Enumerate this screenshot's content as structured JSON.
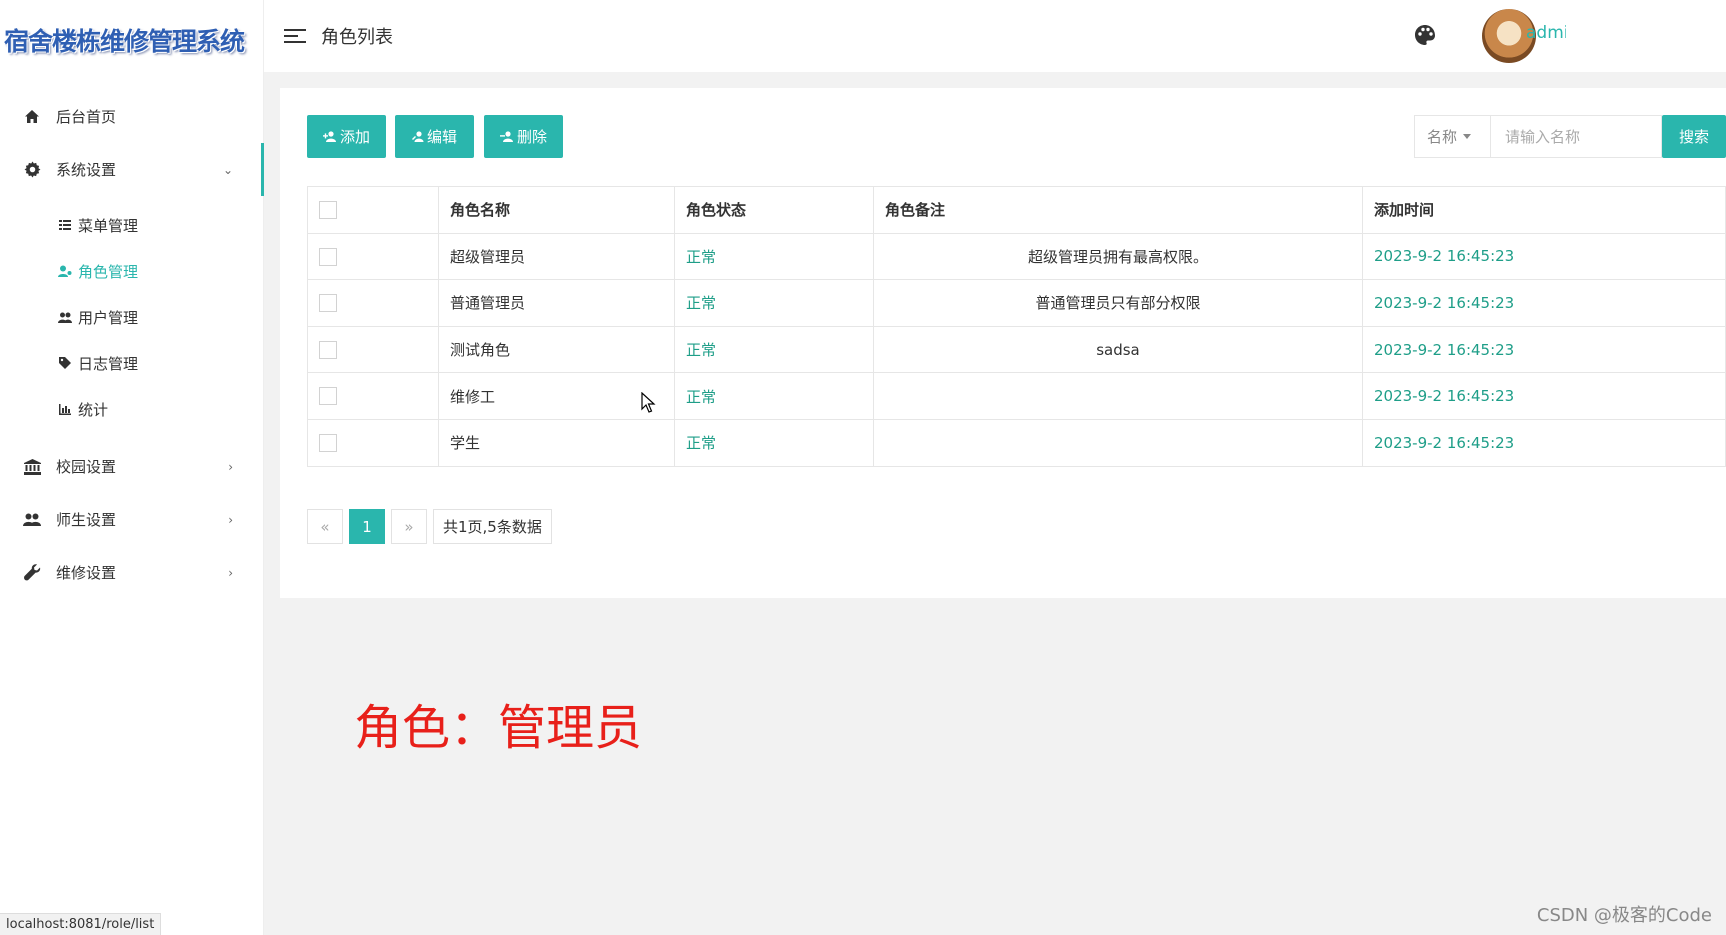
{
  "app": {
    "title": "宿舍楼栋维修管理系统",
    "username": "admin"
  },
  "header": {
    "page_title": "角色列表"
  },
  "sidebar": {
    "items": [
      {
        "label": "后台首页",
        "icon": "home-icon"
      },
      {
        "label": "系统设置",
        "icon": "gear-icon",
        "expanded": true,
        "children": [
          {
            "label": "菜单管理",
            "icon": "list-icon"
          },
          {
            "label": "角色管理",
            "icon": "user-role-icon",
            "active": true
          },
          {
            "label": "用户管理",
            "icon": "users-icon"
          },
          {
            "label": "日志管理",
            "icon": "tag-icon"
          },
          {
            "label": "统计",
            "icon": "bar-chart-icon"
          }
        ]
      },
      {
        "label": "校园设置",
        "icon": "bank-icon"
      },
      {
        "label": "师生设置",
        "icon": "group-icon"
      },
      {
        "label": "维修设置",
        "icon": "wrench-icon"
      }
    ]
  },
  "toolbar": {
    "add_label": "添加",
    "edit_label": "编辑",
    "delete_label": "删除"
  },
  "search": {
    "field_label": "名称",
    "placeholder": "请输入名称",
    "button_label": "搜索"
  },
  "table": {
    "headers": [
      "角色名称",
      "角色状态",
      "角色备注",
      "添加时间"
    ],
    "rows": [
      {
        "name": "超级管理员",
        "status": "正常",
        "note": "超级管理员拥有最高权限。",
        "time": "2023-9-2 16:45:23"
      },
      {
        "name": "普通管理员",
        "status": "正常",
        "note": "普通管理员只有部分权限",
        "time": "2023-9-2 16:45:23"
      },
      {
        "name": "测试角色",
        "status": "正常",
        "note": "sadsa",
        "time": "2023-9-2 16:45:23"
      },
      {
        "name": "维修工",
        "status": "正常",
        "note": "",
        "time": "2023-9-2 16:45:23"
      },
      {
        "name": "学生",
        "status": "正常",
        "note": "",
        "time": "2023-9-2 16:45:23"
      }
    ]
  },
  "pagination": {
    "prev": "«",
    "current": "1",
    "next": "»",
    "info": "共1页,5条数据"
  },
  "annotation": "角色：管理员",
  "status_url": "localhost:8081/role/list",
  "watermark": "CSDN @极客的Code",
  "colors": {
    "accent": "#2ab6ad",
    "status_green": "#1e9e88",
    "annotation_red": "#e8201a"
  }
}
